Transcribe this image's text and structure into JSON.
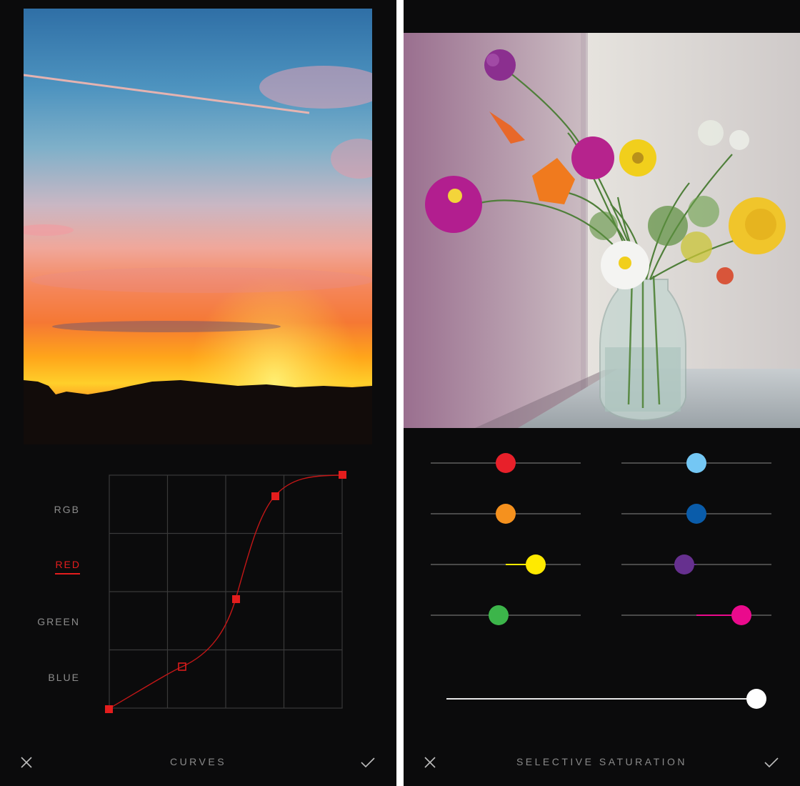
{
  "curves_screen": {
    "channels": [
      {
        "label": "RGB",
        "active": false
      },
      {
        "label": "RED",
        "active": true
      },
      {
        "label": "GREEN",
        "active": false
      },
      {
        "label": "BLUE",
        "active": false
      }
    ],
    "active_channel_color": "#e41d1d",
    "tool_title": "CURVES",
    "cancel_icon": "close-icon",
    "confirm_icon": "checkmark-icon"
  },
  "saturation_screen": {
    "tool_title": "SELECTIVE SATURATION",
    "cancel_icon": "close-icon",
    "confirm_icon": "checkmark-icon",
    "color_sliders": [
      {
        "color_name": "red",
        "color": "#e8202a",
        "value": 0.5
      },
      {
        "color_name": "light-blue",
        "color": "#74c7f4",
        "value": 0.5
      },
      {
        "color_name": "orange",
        "color": "#f5911e",
        "value": 0.5
      },
      {
        "color_name": "blue",
        "color": "#0a5caa",
        "value": 0.5
      },
      {
        "color_name": "yellow",
        "color": "#ffea00",
        "value": 0.7
      },
      {
        "color_name": "purple",
        "color": "#66308f",
        "value": 0.42
      },
      {
        "color_name": "green",
        "color": "#3cb54a",
        "value": 0.45
      },
      {
        "color_name": "magenta",
        "color": "#ea0a8c",
        "value": 0.8
      }
    ],
    "master_value": 1.0
  }
}
